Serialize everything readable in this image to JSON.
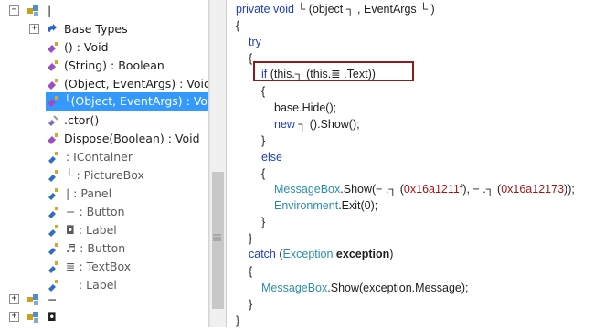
{
  "tree": {
    "root_label": "|",
    "base_types_label": "Base Types",
    "items": [
      {
        "label": "() : Void"
      },
      {
        "label": "(String) : Boolean"
      },
      {
        "label": "(Object, EventArgs) : Void"
      },
      {
        "label": "└(Object, EventArgs) : Void"
      },
      {
        "label": ".ctor()"
      },
      {
        "label": "Dispose(Boolean) : Void"
      },
      {
        "label": ": IContainer"
      },
      {
        "label": "└ : PictureBox"
      },
      {
        "label": "| : Panel"
      },
      {
        "label": "− : Button"
      },
      {
        "label": "◘ : Label"
      },
      {
        "label": "♬ : Button"
      },
      {
        "label": "≣ : TextBox"
      },
      {
        "label": ": Label"
      }
    ],
    "bottom_items": [
      {
        "label": "−"
      },
      {
        "label": "◘"
      }
    ]
  },
  "code": {
    "lines": [
      {
        "parts": [
          {
            "t": "private void",
            "c": "kw"
          },
          {
            "t": " └ (object ┐ , EventArgs └ )"
          }
        ]
      },
      {
        "parts": [
          {
            "t": "{"
          }
        ]
      },
      {
        "parts": [
          {
            "t": "try",
            "c": "kw"
          }
        ]
      },
      {
        "parts": [
          {
            "t": "{"
          }
        ]
      },
      {
        "parts": [
          {
            "t": "if",
            "c": "kw"
          },
          {
            "t": " (this.┐ (this.≣ .Text))"
          }
        ]
      },
      {
        "parts": [
          {
            "t": "{"
          }
        ]
      },
      {
        "parts": [
          {
            "t": "base.Hide();"
          }
        ]
      },
      {
        "parts": [
          {
            "t": "new",
            "c": "kw"
          },
          {
            "t": " ┐ ().Show();"
          }
        ]
      },
      {
        "parts": [
          {
            "t": "}"
          }
        ]
      },
      {
        "parts": [
          {
            "t": "else",
            "c": "kw"
          }
        ]
      },
      {
        "parts": [
          {
            "t": "{"
          }
        ]
      },
      {
        "parts": [
          {
            "t": "MessageBox",
            "c": "ty"
          },
          {
            "t": ".Show(− .┐ ("
          },
          {
            "t": "0x16a1211f",
            "c": "num"
          },
          {
            "t": "), − .┐ ("
          },
          {
            "t": "0x16a12173",
            "c": "num"
          },
          {
            "t": "));"
          }
        ]
      },
      {
        "parts": [
          {
            "t": "Environment",
            "c": "ty"
          },
          {
            "t": ".Exit(0);"
          }
        ]
      },
      {
        "parts": [
          {
            "t": "}"
          }
        ]
      },
      {
        "parts": [
          {
            "t": "}"
          }
        ]
      },
      {
        "parts": [
          {
            "t": "catch",
            "c": "kw"
          },
          {
            "t": " ("
          },
          {
            "t": "Exception",
            "c": "ty"
          },
          {
            "t": " "
          },
          {
            "t": "exception",
            "c": "bold"
          },
          {
            "t": ")"
          }
        ]
      },
      {
        "parts": [
          {
            "t": "{"
          }
        ]
      },
      {
        "parts": [
          {
            "t": "MessageBox",
            "c": "ty"
          },
          {
            "t": ".Show(exception.Message);"
          }
        ]
      },
      {
        "parts": [
          {
            "t": "}"
          }
        ]
      },
      {
        "parts": [
          {
            "t": "}"
          }
        ]
      }
    ]
  }
}
